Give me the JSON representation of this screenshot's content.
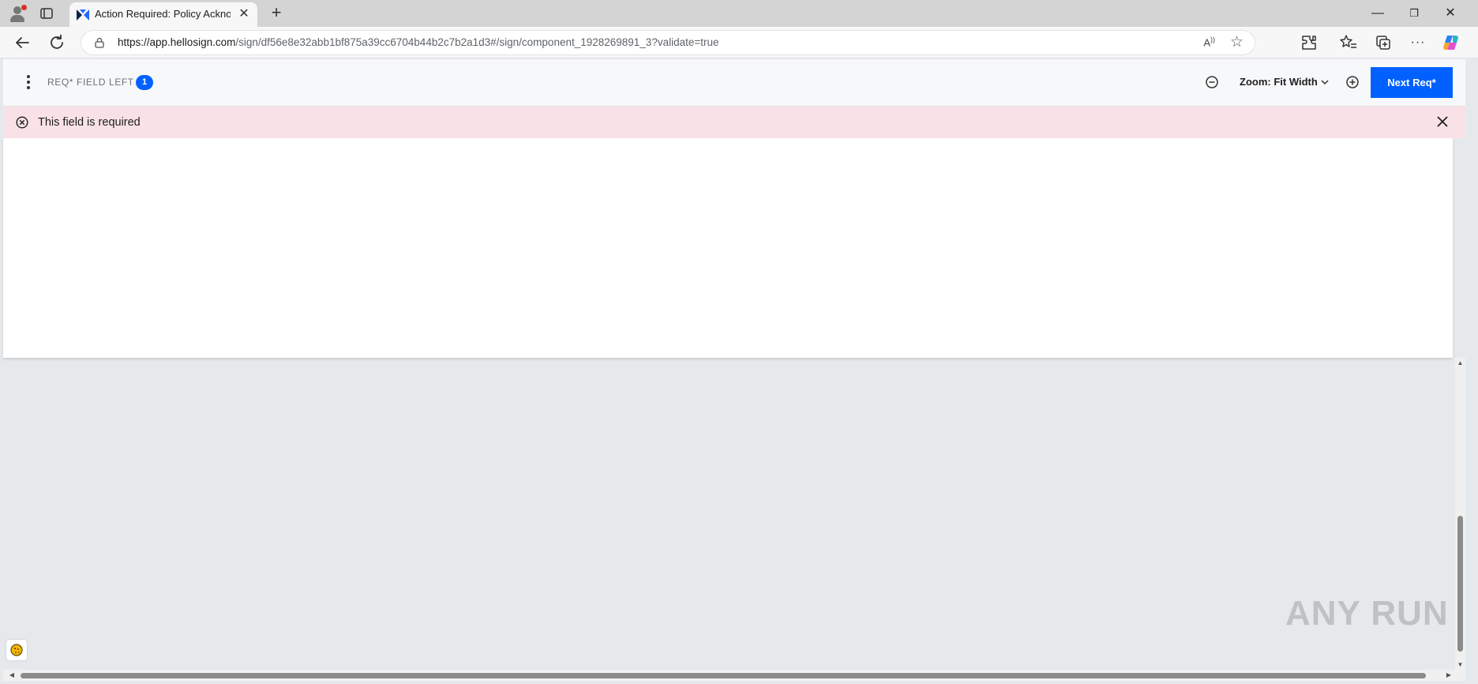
{
  "browser": {
    "tab_title": "Action Required: Policy Acknowle",
    "url_host": "https://app.hellosign.com",
    "url_path": "/sign/df56e8e32abb1bf875a39cc6704b44b2c7b2a1d3#/sign/component_1928269891_3?validate=true",
    "new_tab_glyph": "+",
    "close_tab_glyph": "✕",
    "window_controls": {
      "minimize": "—",
      "maximize": "❐",
      "close": "✕"
    },
    "icons": [
      "profile-icon",
      "tab-actions-icon",
      "dropbox-sign-favicon",
      "back-icon",
      "refresh-icon",
      "lock-icon",
      "read-aloud-icon",
      "favorite-star-icon",
      "extensions-icon",
      "favorites-icon",
      "collections-icon",
      "more-icon",
      "copilot-icon"
    ]
  },
  "toolbar": {
    "req_label": "REQ* FIELD LEFT",
    "req_count": "1",
    "zoom_label": "Zoom: Fit Width",
    "next_button": "Next Req*"
  },
  "banner": {
    "message": "This field is required",
    "background": "#f9e2e7"
  },
  "colors": {
    "accent": "#0061fe",
    "page_bg": "#e6e9ec"
  },
  "watermark": "ANY RUN"
}
